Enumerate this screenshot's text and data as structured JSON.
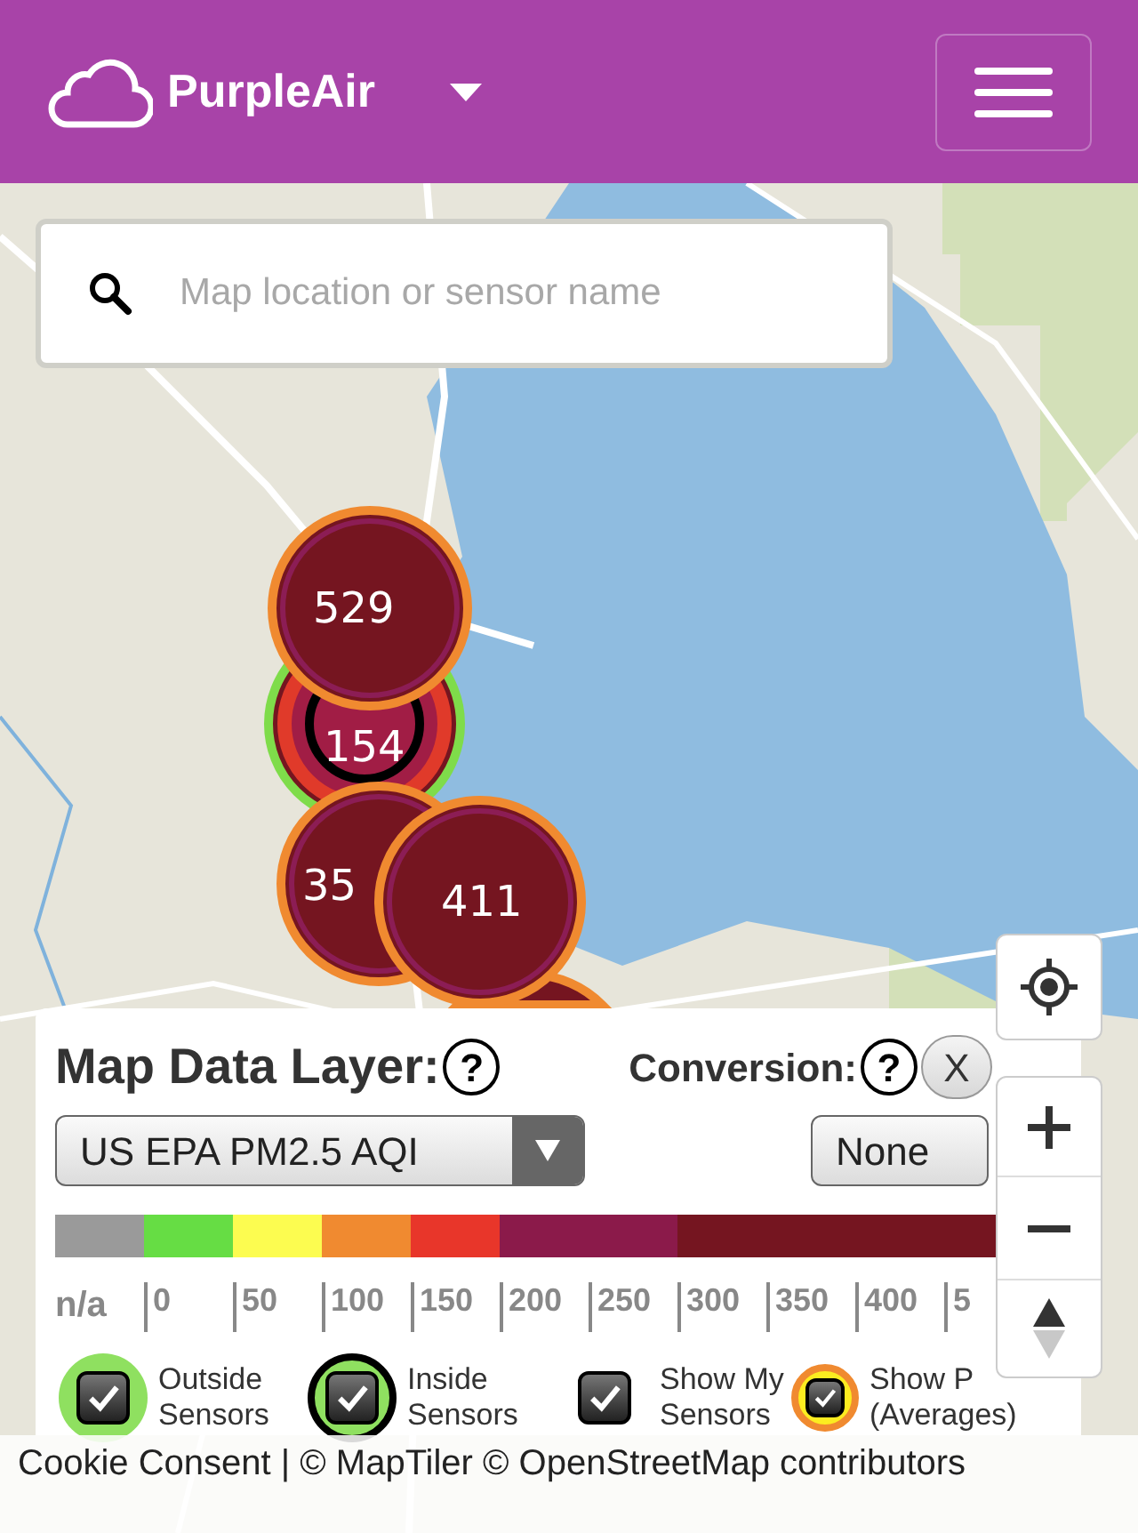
{
  "header": {
    "brand": "PurpleAir"
  },
  "search": {
    "placeholder": "Map location or sensor name"
  },
  "clusters": [
    {
      "label": "529",
      "color": "#f08a30",
      "kind": "plain"
    },
    {
      "label": "154",
      "color": "#7fdc4a",
      "kind": "inside"
    },
    {
      "label": "35",
      "color": "#f08a30",
      "kind": "plain"
    },
    {
      "label": "411",
      "color": "#f08a30",
      "kind": "plain"
    },
    {
      "color": "#f08a30"
    }
  ],
  "panel": {
    "layer_label": "Map Data Layer:",
    "help": "?",
    "layer_value": "US EPA PM2.5 AQI",
    "conversion_label": "Conversion:",
    "conversion_help": "?",
    "close": "X",
    "conversion_value": "None",
    "scale_bands": [
      {
        "color": "#9a9a9a"
      },
      {
        "color": "#66dd44"
      },
      {
        "color": "#fcfc50"
      },
      {
        "color": "#f08a30"
      },
      {
        "color": "#e8362a"
      },
      {
        "color": "#8b1a4a"
      },
      {
        "color": "#751520"
      }
    ],
    "scale_labels": [
      "n/a",
      "0",
      "50",
      "100",
      "150",
      "200",
      "250",
      "300",
      "350",
      "400",
      "5"
    ],
    "toggles": [
      {
        "kind": "outside",
        "checked": true,
        "lines": [
          "Outside",
          "Sensors"
        ]
      },
      {
        "kind": "inside",
        "checked": true,
        "lines": [
          "Inside",
          "Sensors"
        ]
      },
      {
        "kind": "mine",
        "checked": true,
        "lines": [
          "Show My",
          "Sensors"
        ]
      },
      {
        "kind": "averages",
        "checked": true,
        "lines": [
          "Show P",
          "(Averages)"
        ]
      }
    ]
  },
  "attribution": "Cookie Consent | © MapTiler © OpenStreetMap contributors"
}
